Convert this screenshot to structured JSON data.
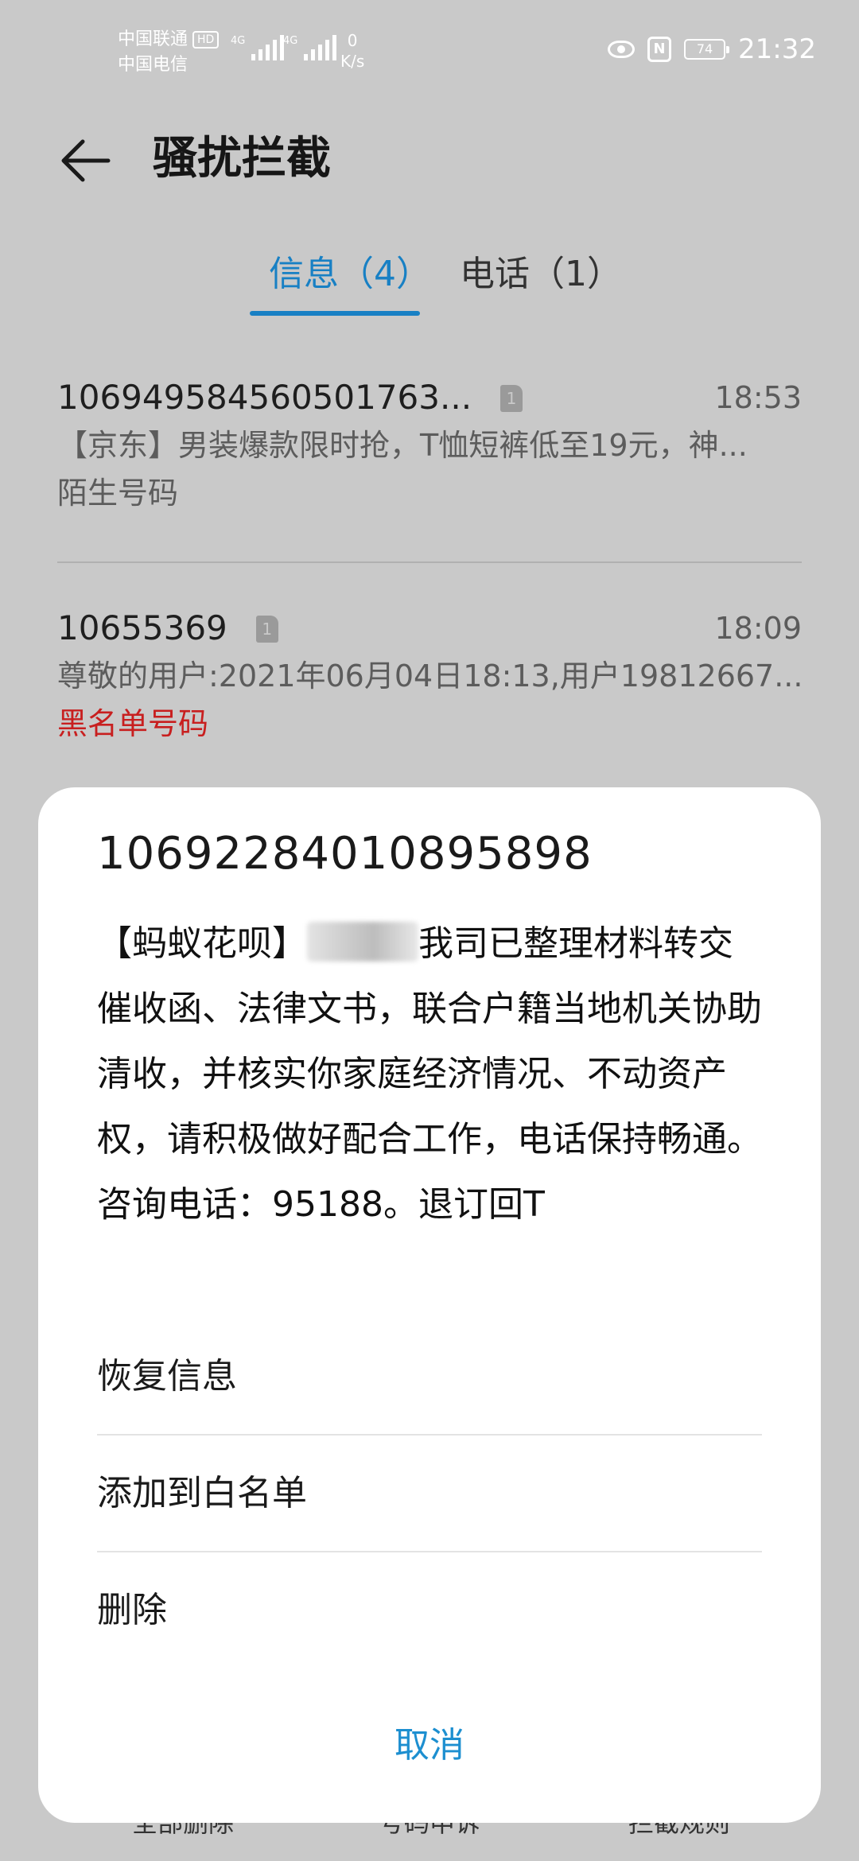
{
  "status_bar": {
    "carrier_1": "中国联通",
    "hd_badge": "HD",
    "carrier_2": "中国电信",
    "signal_1_type": "4G",
    "signal_2_type": "4G",
    "net_speed_value": "0",
    "net_speed_unit": "K/s",
    "battery_level": "74",
    "nfc_label": "N",
    "time": "21:32"
  },
  "header": {
    "title": "骚扰拦截"
  },
  "tabs": [
    {
      "label": "信息（4）",
      "active": true
    },
    {
      "label": "电话（1）",
      "active": false
    }
  ],
  "messages": [
    {
      "sender": "106949584560501763...",
      "sim": "1",
      "time": "18:53",
      "preview": "【京东】男装爆款限时抢，T恤短裤低至19元，神...",
      "tag": "陌生号码",
      "tag_color": "#5c5c5c"
    },
    {
      "sender": "10655369",
      "sim": "1",
      "time": "18:09",
      "preview": "尊敬的用户:2021年06月04日18:13,用户19812667...",
      "tag": "黑名单号码",
      "tag_color": "#c81f1f"
    }
  ],
  "bottom_bar": {
    "delete_all": "全部删除",
    "number_appeal": "号码申诉",
    "block_rules": "拦截规则"
  },
  "sheet": {
    "number": "10692284010895898",
    "body_prefix": "【蚂蚁花呗】",
    "body_rest": "我司已整理材料转交催收函、法律文书，联合户籍当地机关协助清收，并核实你家庭经济情况、不动资产权，请积极做好配合工作，电话保持畅通。咨询电话：95188。退订回T",
    "actions": [
      {
        "label": "恢复信息"
      },
      {
        "label": "添加到白名单"
      },
      {
        "label": "删除"
      }
    ],
    "cancel": "取消"
  },
  "colors": {
    "accent": "#1880c4",
    "cancel": "#1d8fd0",
    "blacklist_red": "#c81f1f"
  }
}
